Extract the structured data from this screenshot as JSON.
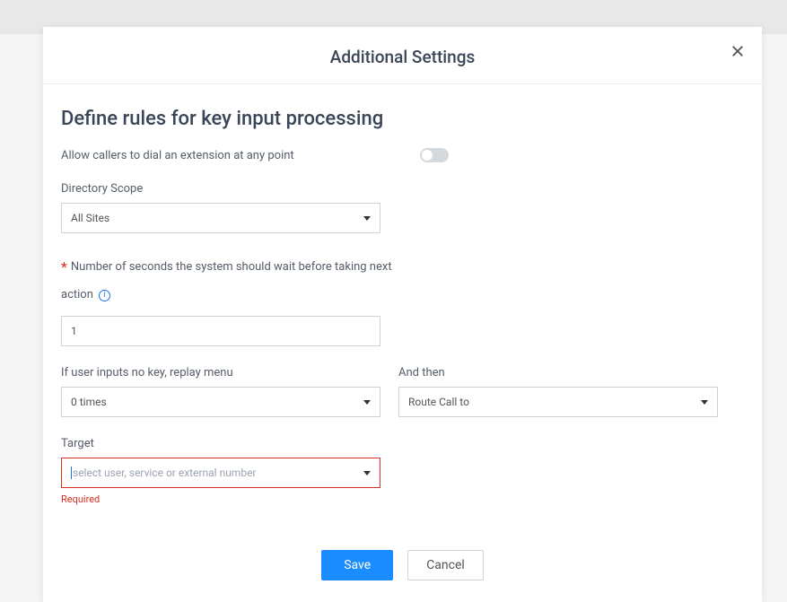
{
  "modal": {
    "title": "Additional Settings",
    "section_title": "Define rules for key input processing",
    "allow_callers_label": "Allow callers to dial an extension at any point",
    "allow_callers_toggle": false,
    "directory_scope": {
      "label": "Directory Scope",
      "selected": "All Sites"
    },
    "wait_seconds": {
      "prefix_asterisk": "*",
      "label_part1": "Number of seconds the system should wait before taking next",
      "label_part2": "action",
      "value": "1"
    },
    "replay_menu": {
      "label": "If user inputs no key, replay menu",
      "selected": "0 times"
    },
    "and_then": {
      "label": "And then",
      "selected": "Route Call to"
    },
    "target": {
      "label": "Target",
      "placeholder": "select user, service or external number",
      "error": "Required"
    },
    "buttons": {
      "save": "Save",
      "cancel": "Cancel"
    }
  }
}
